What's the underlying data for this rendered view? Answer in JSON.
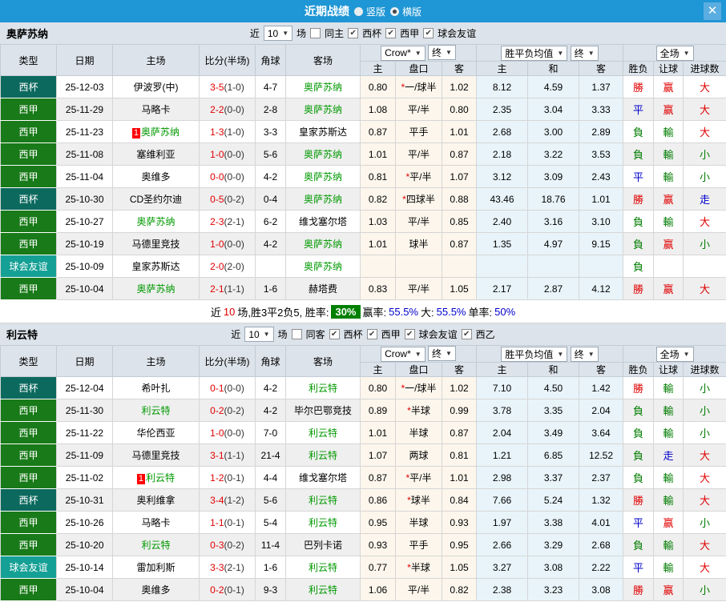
{
  "titlebar": {
    "title": "近期战绩",
    "radio_vertical": "竖版",
    "radio_horizontal": "横版",
    "close_icon": "✕"
  },
  "filters": {
    "near": "近",
    "count": "10",
    "games": "场"
  },
  "headers": {
    "type": "类型",
    "date": "日期",
    "home": "主场",
    "score": "比分(半场)",
    "corner": "角球",
    "away": "客场",
    "sub": [
      "主",
      "盘口",
      "客",
      "主",
      "和",
      "客",
      "胜负",
      "让球",
      "进球数"
    ],
    "dd_odds": "Crow*",
    "dd_final1": "终",
    "dd_avg": "胜平负均值",
    "dd_final2": "终",
    "dd_scope": "全场"
  },
  "result_colors": {
    "R": "#e10000",
    "G": "#007d00",
    "B": "#0000cc"
  },
  "sections": [
    {
      "team": "奥萨苏纳",
      "same_label": "同主",
      "same_checked": false,
      "leagues": [
        {
          "label": "西杯",
          "checked": true
        },
        {
          "label": "西甲",
          "checked": true
        },
        {
          "label": "球会友谊",
          "checked": true
        }
      ],
      "rows": [
        {
          "type": "西杯",
          "tc": "cup",
          "date": "25-12-03",
          "home": "伊波罗(中)",
          "home_self": false,
          "badge": false,
          "ft": "3-5",
          "ht": "(1-0)",
          "corner": "4-7",
          "away": "奥萨苏纳",
          "away_self": true,
          "o1": "0.80",
          "hstar": true,
          "hc": "一/球半",
          "o2": "1.02",
          "a1": "8.12",
          "a2": "4.59",
          "a3": "1.37",
          "r": "勝",
          "rc": "R",
          "h": "赢",
          "hcl": "R",
          "g": "大",
          "gc": "R"
        },
        {
          "type": "西甲",
          "tc": "liga",
          "date": "25-11-29",
          "home": "马略卡",
          "home_self": false,
          "badge": false,
          "ft": "2-2",
          "ht": "(0-0)",
          "corner": "2-8",
          "away": "奥萨苏纳",
          "away_self": true,
          "o1": "1.08",
          "hstar": false,
          "hc": "平/半",
          "o2": "0.80",
          "a1": "2.35",
          "a2": "3.04",
          "a3": "3.33",
          "r": "平",
          "rc": "B",
          "h": "赢",
          "hcl": "R",
          "g": "大",
          "gc": "R"
        },
        {
          "type": "西甲",
          "tc": "liga",
          "date": "25-11-23",
          "home": "奥萨苏纳",
          "home_self": true,
          "badge": true,
          "ft": "1-3",
          "ht": "(1-0)",
          "corner": "3-3",
          "away": "皇家苏斯达",
          "away_self": false,
          "o1": "0.87",
          "hstar": false,
          "hc": "平手",
          "o2": "1.01",
          "a1": "2.68",
          "a2": "3.00",
          "a3": "2.89",
          "r": "負",
          "rc": "G",
          "h": "輸",
          "hcl": "G",
          "g": "大",
          "gc": "R"
        },
        {
          "type": "西甲",
          "tc": "liga",
          "date": "25-11-08",
          "home": "塞维利亚",
          "home_self": false,
          "badge": false,
          "ft": "1-0",
          "ht": "(0-0)",
          "corner": "5-6",
          "away": "奥萨苏纳",
          "away_self": true,
          "o1": "1.01",
          "hstar": false,
          "hc": "平/半",
          "o2": "0.87",
          "a1": "2.18",
          "a2": "3.22",
          "a3": "3.53",
          "r": "負",
          "rc": "G",
          "h": "輸",
          "hcl": "G",
          "g": "小",
          "gc": "G"
        },
        {
          "type": "西甲",
          "tc": "liga",
          "date": "25-11-04",
          "home": "奥维多",
          "home_self": false,
          "badge": false,
          "ft": "0-0",
          "ht": "(0-0)",
          "corner": "4-2",
          "away": "奥萨苏纳",
          "away_self": true,
          "o1": "0.81",
          "hstar": true,
          "hc": "平/半",
          "o2": "1.07",
          "a1": "3.12",
          "a2": "3.09",
          "a3": "2.43",
          "r": "平",
          "rc": "B",
          "h": "輸",
          "hcl": "G",
          "g": "小",
          "gc": "G"
        },
        {
          "type": "西杯",
          "tc": "cup",
          "date": "25-10-30",
          "home": "CD圣约尔迪",
          "home_self": false,
          "badge": false,
          "ft": "0-5",
          "ht": "(0-2)",
          "corner": "0-4",
          "away": "奥萨苏纳",
          "away_self": true,
          "o1": "0.82",
          "hstar": true,
          "hc": "四球半",
          "o2": "0.88",
          "a1": "43.46",
          "a2": "18.76",
          "a3": "1.01",
          "r": "勝",
          "rc": "R",
          "h": "赢",
          "hcl": "R",
          "g": "走",
          "gc": "B"
        },
        {
          "type": "西甲",
          "tc": "liga",
          "date": "25-10-27",
          "home": "奥萨苏纳",
          "home_self": true,
          "badge": false,
          "ft": "2-3",
          "ht": "(2-1)",
          "corner": "6-2",
          "away": "维戈塞尔塔",
          "away_self": false,
          "o1": "1.03",
          "hstar": false,
          "hc": "平/半",
          "o2": "0.85",
          "a1": "2.40",
          "a2": "3.16",
          "a3": "3.10",
          "r": "負",
          "rc": "G",
          "h": "輸",
          "hcl": "G",
          "g": "大",
          "gc": "R"
        },
        {
          "type": "西甲",
          "tc": "liga",
          "date": "25-10-19",
          "home": "马德里竞技",
          "home_self": false,
          "badge": false,
          "ft": "1-0",
          "ht": "(0-0)",
          "corner": "4-2",
          "away": "奥萨苏纳",
          "away_self": true,
          "o1": "1.01",
          "hstar": false,
          "hc": "球半",
          "o2": "0.87",
          "a1": "1.35",
          "a2": "4.97",
          "a3": "9.15",
          "r": "負",
          "rc": "G",
          "h": "赢",
          "hcl": "R",
          "g": "小",
          "gc": "G"
        },
        {
          "type": "球会友谊",
          "tc": "friendly",
          "date": "25-10-09",
          "home": "皇家苏斯达",
          "home_self": false,
          "badge": false,
          "ft": "2-0",
          "ht": "(2-0)",
          "corner": "",
          "away": "奥萨苏纳",
          "away_self": true,
          "o1": "",
          "hstar": false,
          "hc": "",
          "o2": "",
          "a1": "",
          "a2": "",
          "a3": "",
          "r": "負",
          "rc": "G",
          "h": "",
          "hcl": "G",
          "g": "",
          "gc": "G"
        },
        {
          "type": "西甲",
          "tc": "liga",
          "date": "25-10-04",
          "home": "奥萨苏纳",
          "home_self": true,
          "badge": false,
          "ft": "2-1",
          "ht": "(1-1)",
          "corner": "1-6",
          "away": "赫塔费",
          "away_self": false,
          "o1": "0.83",
          "hstar": false,
          "hc": "平/半",
          "o2": "1.05",
          "a1": "2.17",
          "a2": "2.87",
          "a3": "4.12",
          "r": "勝",
          "rc": "R",
          "h": "赢",
          "hcl": "R",
          "g": "大",
          "gc": "R"
        }
      ],
      "summary": {
        "pre": "近",
        "num": "10",
        "mid": "场,胜3平2负5, 胜率:",
        "rate": "30%",
        "items": [
          {
            "label": "赢率:",
            "value": "55.5%"
          },
          {
            "label": "大:",
            "value": "55.5%"
          },
          {
            "label": "单率:",
            "value": "50%"
          }
        ]
      }
    },
    {
      "team": "利云特",
      "same_label": "同客",
      "same_checked": false,
      "leagues": [
        {
          "label": "西杯",
          "checked": true
        },
        {
          "label": "西甲",
          "checked": true
        },
        {
          "label": "球会友谊",
          "checked": true
        },
        {
          "label": "西乙",
          "checked": true
        }
      ],
      "rows": [
        {
          "type": "西杯",
          "tc": "cup",
          "date": "25-12-04",
          "home": "希叶扎",
          "home_self": false,
          "badge": false,
          "ft": "0-1",
          "ht": "(0-0)",
          "corner": "4-2",
          "away": "利云特",
          "away_self": true,
          "o1": "0.80",
          "hstar": true,
          "hc": "一/球半",
          "o2": "1.02",
          "a1": "7.10",
          "a2": "4.50",
          "a3": "1.42",
          "r": "勝",
          "rc": "R",
          "h": "輸",
          "hcl": "G",
          "g": "小",
          "gc": "G"
        },
        {
          "type": "西甲",
          "tc": "liga",
          "date": "25-11-30",
          "home": "利云特",
          "home_self": true,
          "badge": false,
          "ft": "0-2",
          "ht": "(0-2)",
          "corner": "4-2",
          "away": "毕尔巴鄂竞技",
          "away_self": false,
          "o1": "0.89",
          "hstar": true,
          "hc": "半球",
          "o2": "0.99",
          "a1": "3.78",
          "a2": "3.35",
          "a3": "2.04",
          "r": "負",
          "rc": "G",
          "h": "輸",
          "hcl": "G",
          "g": "小",
          "gc": "G"
        },
        {
          "type": "西甲",
          "tc": "liga",
          "date": "25-11-22",
          "home": "华伦西亚",
          "home_self": false,
          "badge": false,
          "ft": "1-0",
          "ht": "(0-0)",
          "corner": "7-0",
          "away": "利云特",
          "away_self": true,
          "o1": "1.01",
          "hstar": false,
          "hc": "半球",
          "o2": "0.87",
          "a1": "2.04",
          "a2": "3.49",
          "a3": "3.64",
          "r": "負",
          "rc": "G",
          "h": "輸",
          "hcl": "G",
          "g": "小",
          "gc": "G"
        },
        {
          "type": "西甲",
          "tc": "liga",
          "date": "25-11-09",
          "home": "马德里竞技",
          "home_self": false,
          "badge": false,
          "ft": "3-1",
          "ht": "(1-1)",
          "corner": "21-4",
          "away": "利云特",
          "away_self": true,
          "o1": "1.07",
          "hstar": false,
          "hc": "两球",
          "o2": "0.81",
          "a1": "1.21",
          "a2": "6.85",
          "a3": "12.52",
          "r": "負",
          "rc": "G",
          "h": "走",
          "hcl": "B",
          "g": "大",
          "gc": "R"
        },
        {
          "type": "西甲",
          "tc": "liga",
          "date": "25-11-02",
          "home": "利云特",
          "home_self": true,
          "badge": true,
          "ft": "1-2",
          "ht": "(0-1)",
          "corner": "4-4",
          "away": "维戈塞尔塔",
          "away_self": false,
          "o1": "0.87",
          "hstar": true,
          "hc": "平/半",
          "o2": "1.01",
          "a1": "2.98",
          "a2": "3.37",
          "a3": "2.37",
          "r": "負",
          "rc": "G",
          "h": "輸",
          "hcl": "G",
          "g": "大",
          "gc": "R"
        },
        {
          "type": "西杯",
          "tc": "cup",
          "date": "25-10-31",
          "home": "奥利维拿",
          "home_self": false,
          "badge": false,
          "ft": "3-4",
          "ht": "(1-2)",
          "corner": "5-6",
          "away": "利云特",
          "away_self": true,
          "o1": "0.86",
          "hstar": true,
          "hc": "球半",
          "o2": "0.84",
          "a1": "7.66",
          "a2": "5.24",
          "a3": "1.32",
          "r": "勝",
          "rc": "R",
          "h": "輸",
          "hcl": "G",
          "g": "大",
          "gc": "R"
        },
        {
          "type": "西甲",
          "tc": "liga",
          "date": "25-10-26",
          "home": "马略卡",
          "home_self": false,
          "badge": false,
          "ft": "1-1",
          "ht": "(0-1)",
          "corner": "5-4",
          "away": "利云特",
          "away_self": true,
          "o1": "0.95",
          "hstar": false,
          "hc": "半球",
          "o2": "0.93",
          "a1": "1.97",
          "a2": "3.38",
          "a3": "4.01",
          "r": "平",
          "rc": "B",
          "h": "赢",
          "hcl": "R",
          "g": "小",
          "gc": "G"
        },
        {
          "type": "西甲",
          "tc": "liga",
          "date": "25-10-20",
          "home": "利云特",
          "home_self": true,
          "badge": false,
          "ft": "0-3",
          "ht": "(0-2)",
          "corner": "11-4",
          "away": "巴列卡诺",
          "away_self": false,
          "o1": "0.93",
          "hstar": false,
          "hc": "平手",
          "o2": "0.95",
          "a1": "2.66",
          "a2": "3.29",
          "a3": "2.68",
          "r": "負",
          "rc": "G",
          "h": "輸",
          "hcl": "G",
          "g": "大",
          "gc": "R"
        },
        {
          "type": "球会友谊",
          "tc": "friendly",
          "date": "25-10-14",
          "home": "雷加利斯",
          "home_self": false,
          "badge": false,
          "ft": "3-3",
          "ht": "(2-1)",
          "corner": "1-6",
          "away": "利云特",
          "away_self": true,
          "o1": "0.77",
          "hstar": true,
          "hc": "半球",
          "o2": "1.05",
          "a1": "3.27",
          "a2": "3.08",
          "a3": "2.22",
          "r": "平",
          "rc": "B",
          "h": "輸",
          "hcl": "G",
          "g": "大",
          "gc": "R"
        },
        {
          "type": "西甲",
          "tc": "liga",
          "date": "25-10-04",
          "home": "奥维多",
          "home_self": false,
          "badge": false,
          "ft": "0-2",
          "ht": "(0-1)",
          "corner": "9-3",
          "away": "利云特",
          "away_self": true,
          "o1": "1.06",
          "hstar": false,
          "hc": "平/半",
          "o2": "0.82",
          "a1": "2.38",
          "a2": "3.23",
          "a3": "3.08",
          "r": "勝",
          "rc": "R",
          "h": "赢",
          "hcl": "R",
          "g": "小",
          "gc": "G"
        }
      ],
      "summary": null
    }
  ]
}
